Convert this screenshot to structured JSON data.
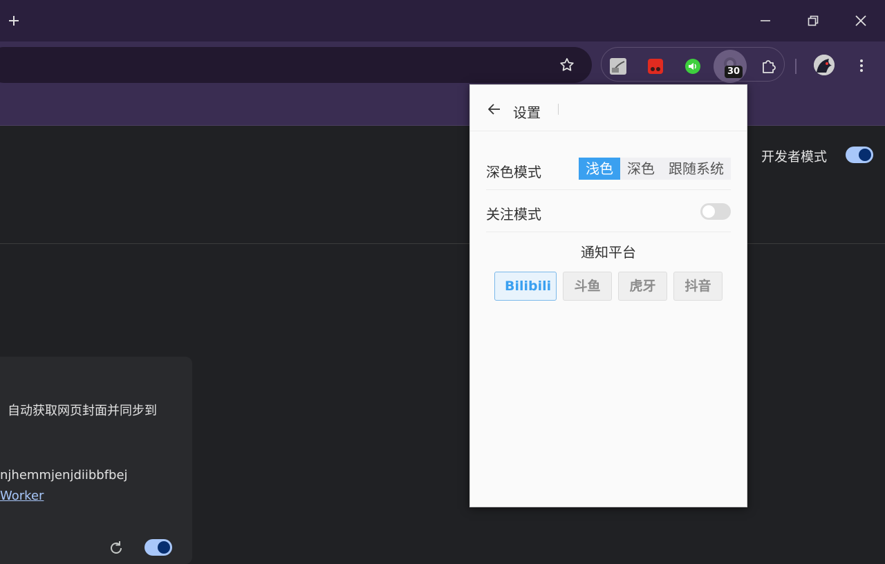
{
  "browser": {
    "badge_count": "30"
  },
  "page": {
    "developer_mode_label": "开发者模式",
    "developer_mode_on": true,
    "card": {
      "description": "自动获取网页封面并同步到",
      "id_fragment": "njhemmjenjdiibbfbej",
      "link_fragment": "Worker",
      "enabled": true
    }
  },
  "popup": {
    "title": "设置",
    "dark_mode": {
      "label": "深色模式",
      "options": [
        "浅色",
        "深色",
        "跟随系统"
      ],
      "selected": "浅色"
    },
    "focus_mode": {
      "label": "关注模式",
      "enabled": false
    },
    "notify": {
      "title": "通知平台",
      "platforms": [
        "Bilibili",
        "斗鱼",
        "虎牙",
        "抖音"
      ],
      "selected": "Bilibili"
    }
  },
  "colors": {
    "accent": "#3aa0f0",
    "toggle_on": "#a8c7fa",
    "titlebar": "#2a1f3d",
    "toolbar": "#3a2d52"
  }
}
